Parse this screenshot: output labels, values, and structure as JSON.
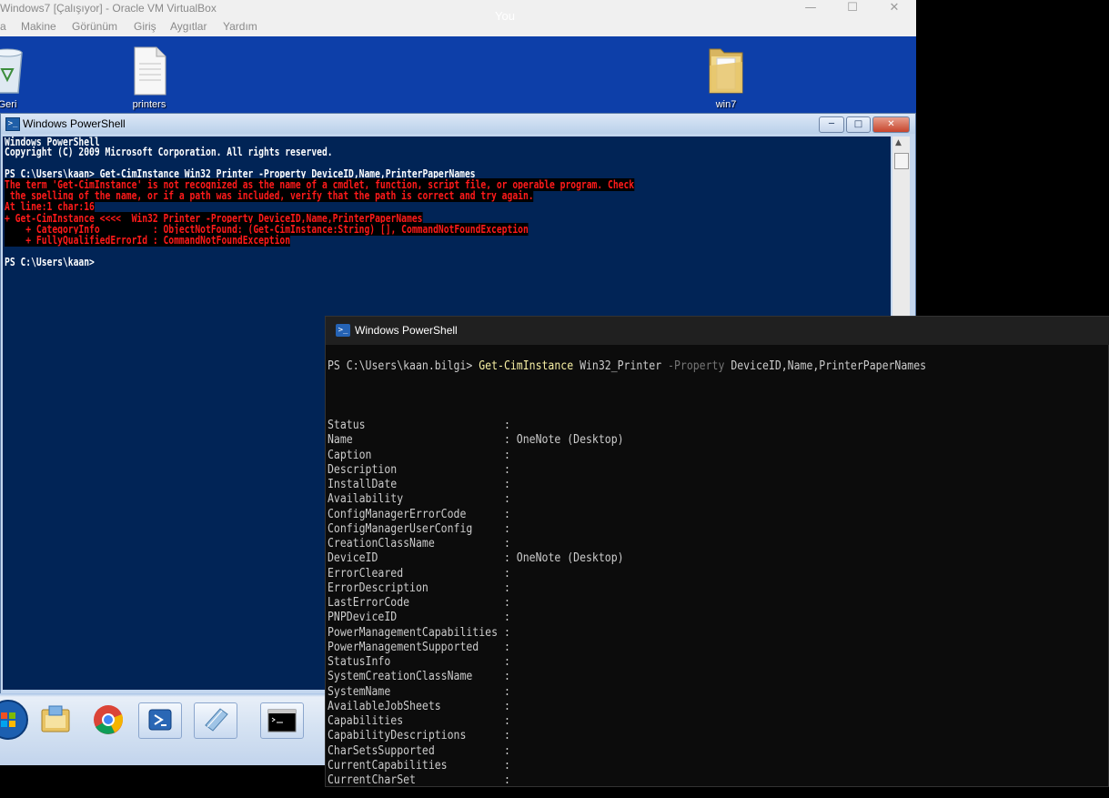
{
  "vbox": {
    "title": "Windows7 [Çalışıyor] - Oracle VM VirtualBox",
    "share_label": "You",
    "menu": [
      "a",
      "Makine",
      "Görünüm",
      "Giriş",
      "Aygıtlar",
      "Yardım"
    ]
  },
  "desktop": {
    "icons": [
      {
        "label": "Geri",
        "icon": "recycle-bin-icon"
      },
      {
        "label": "printers",
        "icon": "text-file-icon"
      },
      {
        "label": "win7",
        "icon": "folder-icon"
      }
    ]
  },
  "guest_ps": {
    "title": "Windows PowerShell",
    "lines": [
      "Windows PowerShell",
      "Copyright (C) 2009 Microsoft Corporation. All rights reserved.",
      "",
      "PS C:\\Users\\kaan> Get-CimInstance Win32_Printer -Property DeviceID,Name,PrinterPaperNames"
    ],
    "error_lines": [
      "The term 'Get-CimInstance' is not recognized as the name of a cmdlet, function, script file, or operable program. Check",
      " the spelling of the name, or if a path was included, verify that the path is correct and try again.",
      "At line:1 char:16",
      "+ Get-CimInstance <<<<  Win32_Printer -Property DeviceID,Name,PrinterPaperNames",
      "    + CategoryInfo          : ObjectNotFound: (Get-CimInstance:String) [], CommandNotFoundException",
      "    + FullyQualifiedErrorId : CommandNotFoundException"
    ],
    "prompt": "PS C:\\Users\\kaan>",
    "colors": {
      "background": "#012456",
      "error": "#ff1a1a"
    }
  },
  "taskbar": {
    "items": [
      "start-orb-icon",
      "explorer-icon",
      "chrome-icon",
      "powershell-icon",
      "notepad-icon",
      "cmd-icon"
    ]
  },
  "terminal": {
    "title": "Windows PowerShell",
    "prompt": "PS C:\\Users\\kaan.bilgi> ",
    "command": {
      "cmdlet": "Get-CimInstance",
      "arg": " Win32_Printer ",
      "param": "-Property",
      "values": " DeviceID,Name,PrinterPaperNames"
    },
    "properties": [
      {
        "name": "Status",
        "value": ""
      },
      {
        "name": "Name",
        "value": "OneNote (Desktop)"
      },
      {
        "name": "Caption",
        "value": ""
      },
      {
        "name": "Description",
        "value": ""
      },
      {
        "name": "InstallDate",
        "value": ""
      },
      {
        "name": "Availability",
        "value": ""
      },
      {
        "name": "ConfigManagerErrorCode",
        "value": ""
      },
      {
        "name": "ConfigManagerUserConfig",
        "value": ""
      },
      {
        "name": "CreationClassName",
        "value": ""
      },
      {
        "name": "DeviceID",
        "value": "OneNote (Desktop)"
      },
      {
        "name": "ErrorCleared",
        "value": ""
      },
      {
        "name": "ErrorDescription",
        "value": ""
      },
      {
        "name": "LastErrorCode",
        "value": ""
      },
      {
        "name": "PNPDeviceID",
        "value": ""
      },
      {
        "name": "PowerManagementCapabilities",
        "value": ""
      },
      {
        "name": "PowerManagementSupported",
        "value": ""
      },
      {
        "name": "StatusInfo",
        "value": ""
      },
      {
        "name": "SystemCreationClassName",
        "value": ""
      },
      {
        "name": "SystemName",
        "value": ""
      },
      {
        "name": "AvailableJobSheets",
        "value": ""
      },
      {
        "name": "Capabilities",
        "value": ""
      },
      {
        "name": "CapabilityDescriptions",
        "value": ""
      },
      {
        "name": "CharSetsSupported",
        "value": ""
      },
      {
        "name": "CurrentCapabilities",
        "value": ""
      },
      {
        "name": "CurrentCharSet",
        "value": ""
      }
    ],
    "colors": {
      "background": "#0c0c0c",
      "cmdlet": "#f9f1a5",
      "parameter": "#767676"
    }
  }
}
